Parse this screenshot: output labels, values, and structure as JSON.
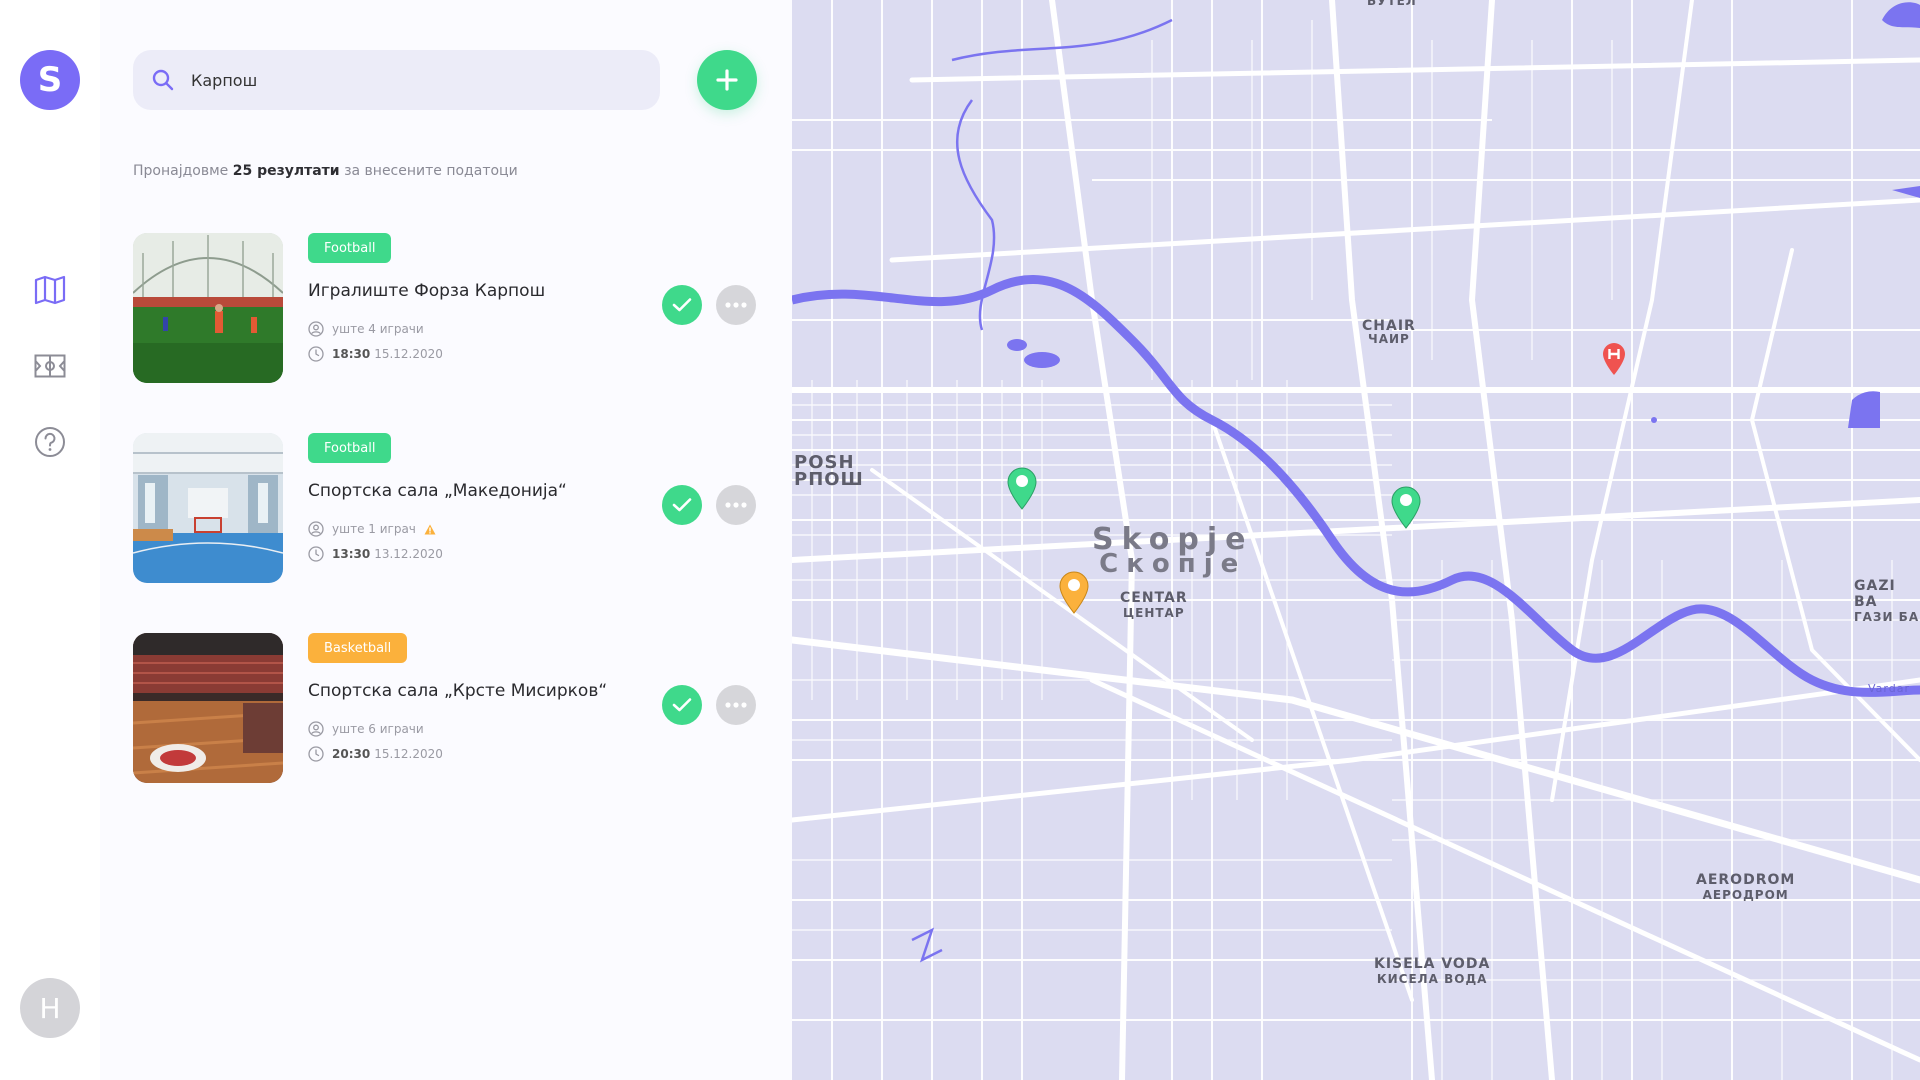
{
  "app": {
    "logo_letter": "S",
    "user_initial": "H"
  },
  "colors": {
    "accent": "#7a6cf6",
    "success": "#3fd98b",
    "football": "#3fd98b",
    "basketball": "#fbb13c",
    "map_bg": "#dcdcf1",
    "river": "#7b74f0"
  },
  "sidebar": {
    "icons": [
      {
        "name": "map-icon"
      },
      {
        "name": "field-icon"
      },
      {
        "name": "help-icon"
      }
    ]
  },
  "search": {
    "value": "Карпош",
    "placeholder": ""
  },
  "results": {
    "prefix": "Пронајдовме",
    "count": "25 резултати",
    "suffix": "за внесените податоци"
  },
  "events": [
    {
      "tag": "Football",
      "tag_color": "#3fd98b",
      "title": "Игралиште Форза Карпош",
      "players": "уште 4 играчи",
      "time": "18:30",
      "date": "15.12.2020",
      "warning": false
    },
    {
      "tag": "Football",
      "tag_color": "#3fd98b",
      "title": "Спортска сала „Македонија“",
      "players": "уште 1 играч",
      "time": "13:30",
      "date": "13.12.2020",
      "warning": true
    },
    {
      "tag": "Basketball",
      "tag_color": "#fbb13c",
      "title": "Спортска сала „Крсте Мисирков“",
      "players": "уште 6 играчи",
      "time": "20:30",
      "date": "15.12.2020",
      "warning": false
    }
  ],
  "map": {
    "labels": {
      "city_latin": "Skopje",
      "city_cyr": "Скопје",
      "centar_latin": "CENTAR",
      "centar_cyr": "ЦЕНТАР",
      "chair_latin": "CHAIR",
      "chair_cyr": "ЧАИР",
      "karposh_latin": "POSH",
      "karposh_cyr": "РПОШ",
      "gazi_latin": "GAZI BA",
      "gazi_cyr": "ГАЗИ БА",
      "aerodrom_latin": "AERODROM",
      "aerodrom_cyr": "АЕРОДРОМ",
      "kisela_latin": "KISELA VODA",
      "kisela_cyr": "КИСЕЛА ВОДА",
      "butel_cyr": "БУТЕЛ",
      "river_name": "Vardar"
    },
    "pins": [
      {
        "name": "map-pin-football-1",
        "color": "#3fd98b"
      },
      {
        "name": "map-pin-football-2",
        "color": "#3fd98b"
      },
      {
        "name": "map-pin-basketball",
        "color": "#fbb13c"
      },
      {
        "name": "map-pin-hospital",
        "color": "#ef5350",
        "glyph": "H"
      }
    ]
  }
}
